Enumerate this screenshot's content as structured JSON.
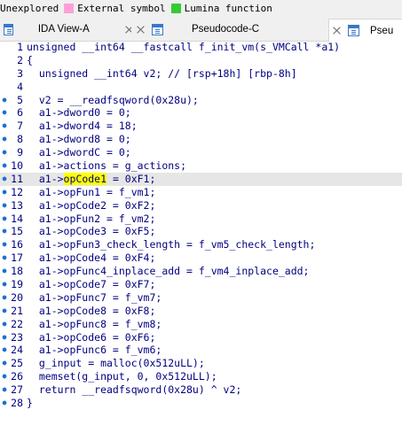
{
  "legend": [
    {
      "label": "Unexplored",
      "color": "#f0f0f0"
    },
    {
      "label": "External symbol",
      "color": "#ff9fd7"
    },
    {
      "label": "Lumina function",
      "color": "#33cc33"
    }
  ],
  "tabs": [
    {
      "label": "IDA View-A",
      "active": false
    },
    {
      "label": "Pseudocode-C",
      "active": false
    },
    {
      "label": "Pseu",
      "active": true
    }
  ],
  "code_lines": [
    {
      "num": "1",
      "dot": false,
      "text": "unsigned __int64 __fastcall f_init_vm(s_VMCall *a1)"
    },
    {
      "num": "2",
      "dot": false,
      "text": "{"
    },
    {
      "num": "3",
      "dot": false,
      "text": "  unsigned __int64 v2; // [rsp+18h] [rbp-8h]"
    },
    {
      "num": "4",
      "dot": false,
      "text": ""
    },
    {
      "num": "5",
      "dot": true,
      "text": "  v2 = __readfsqword(0x28u);"
    },
    {
      "num": "6",
      "dot": true,
      "text": "  a1->dword0 = 0;"
    },
    {
      "num": "7",
      "dot": true,
      "text": "  a1->dword4 = 18;"
    },
    {
      "num": "8",
      "dot": true,
      "text": "  a1->dword8 = 0;"
    },
    {
      "num": "9",
      "dot": true,
      "text": "  a1->dwordC = 0;"
    },
    {
      "num": "10",
      "dot": true,
      "text": "  a1->actions = g_actions;"
    },
    {
      "num": "11",
      "dot": true,
      "text": "  a1->opCode1 = 0xF1;"
    },
    {
      "num": "12",
      "dot": true,
      "text": "  a1->opFun1 = f_vm1;"
    },
    {
      "num": "13",
      "dot": true,
      "text": "  a1->opCode2 = 0xF2;"
    },
    {
      "num": "14",
      "dot": true,
      "text": "  a1->opFun2 = f_vm2;"
    },
    {
      "num": "15",
      "dot": true,
      "text": "  a1->opCode3 = 0xF5;"
    },
    {
      "num": "16",
      "dot": true,
      "text": "  a1->opFun3_check_length = f_vm5_check_length;"
    },
    {
      "num": "17",
      "dot": true,
      "text": "  a1->opCode4 = 0xF4;"
    },
    {
      "num": "18",
      "dot": true,
      "text": "  a1->opFunc4_inplace_add = f_vm4_inplace_add;"
    },
    {
      "num": "19",
      "dot": true,
      "text": "  a1->opCode7 = 0xF7;"
    },
    {
      "num": "20",
      "dot": true,
      "text": "  a1->opFunc7 = f_vm7;"
    },
    {
      "num": "21",
      "dot": true,
      "text": "  a1->opCode8 = 0xF8;"
    },
    {
      "num": "22",
      "dot": true,
      "text": "  a1->opFunc8 = f_vm8;"
    },
    {
      "num": "23",
      "dot": true,
      "text": "  a1->opCode6 = 0xF6;"
    },
    {
      "num": "24",
      "dot": true,
      "text": "  a1->opFunc6 = f_vm6;"
    },
    {
      "num": "25",
      "dot": true,
      "text": "  g_input = malloc(0x512uLL);"
    },
    {
      "num": "26",
      "dot": true,
      "text": "  memset(g_input, 0, 0x512uLL);"
    },
    {
      "num": "27",
      "dot": true,
      "text": "  return __readfsqword(0x28u) ^ v2;"
    },
    {
      "num": "28",
      "dot": true,
      "text": "}"
    }
  ],
  "highlighted_word": "opCode1",
  "highlighted_line": "11"
}
